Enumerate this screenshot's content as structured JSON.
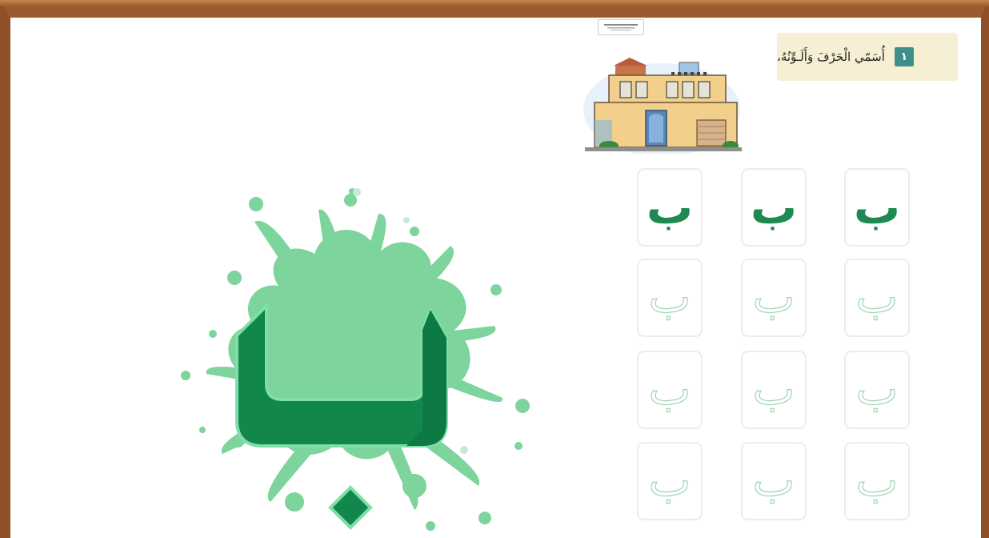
{
  "instruction": {
    "number": "١",
    "text": "أُسَمّي الْحَرْفَ وَأَلَـوِّنُهُ،"
  },
  "stamp": {
    "text": ""
  },
  "letter": {
    "large": "ب"
  },
  "tiles": {
    "solid": [
      "ب",
      "ب",
      "ب"
    ],
    "trace": [
      "ب",
      "ب",
      "ب",
      "ب",
      "ب",
      "ب",
      "ب",
      "ب",
      "ب"
    ]
  },
  "colors": {
    "frame": "#9c5a2e",
    "green_dark": "#1e8a52",
    "green_splash": "#7dd49c",
    "trace": "#9fd4b7",
    "banner": "#f6efd3"
  }
}
